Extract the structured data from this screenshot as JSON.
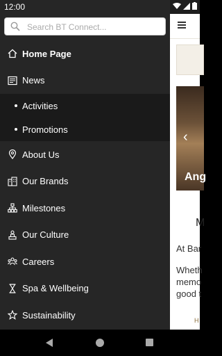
{
  "status": {
    "time": "12:00"
  },
  "search": {
    "placeholder": "Search BT Connect..."
  },
  "menu": {
    "items": [
      {
        "label": "Home Page",
        "icon": "home-icon"
      },
      {
        "label": "News",
        "icon": "news-icon"
      },
      {
        "label": "Activities"
      },
      {
        "label": "Promotions"
      },
      {
        "label": "About Us",
        "icon": "location-pin-icon"
      },
      {
        "label": "Our Brands",
        "icon": "buildings-icon"
      },
      {
        "label": "Milestones",
        "icon": "org-chart-icon"
      },
      {
        "label": "Our Culture",
        "icon": "person-stand-icon"
      },
      {
        "label": "Careers",
        "icon": "team-icon"
      },
      {
        "label": "Spa & Wellbeing",
        "icon": "hourglass-icon"
      },
      {
        "label": "Sustainability",
        "icon": "star-icon"
      }
    ]
  },
  "background": {
    "banner_text": "Ang",
    "heading": "M",
    "para1": "At Bar",
    "para2_line1": "Wheth",
    "para2_line2": "memo",
    "para2_line3": "good t",
    "footnote": "H"
  },
  "colors": {
    "drawer_bg": "#262626",
    "submenu_bg": "#1a1a1a",
    "accent": "#8a6d3b"
  }
}
